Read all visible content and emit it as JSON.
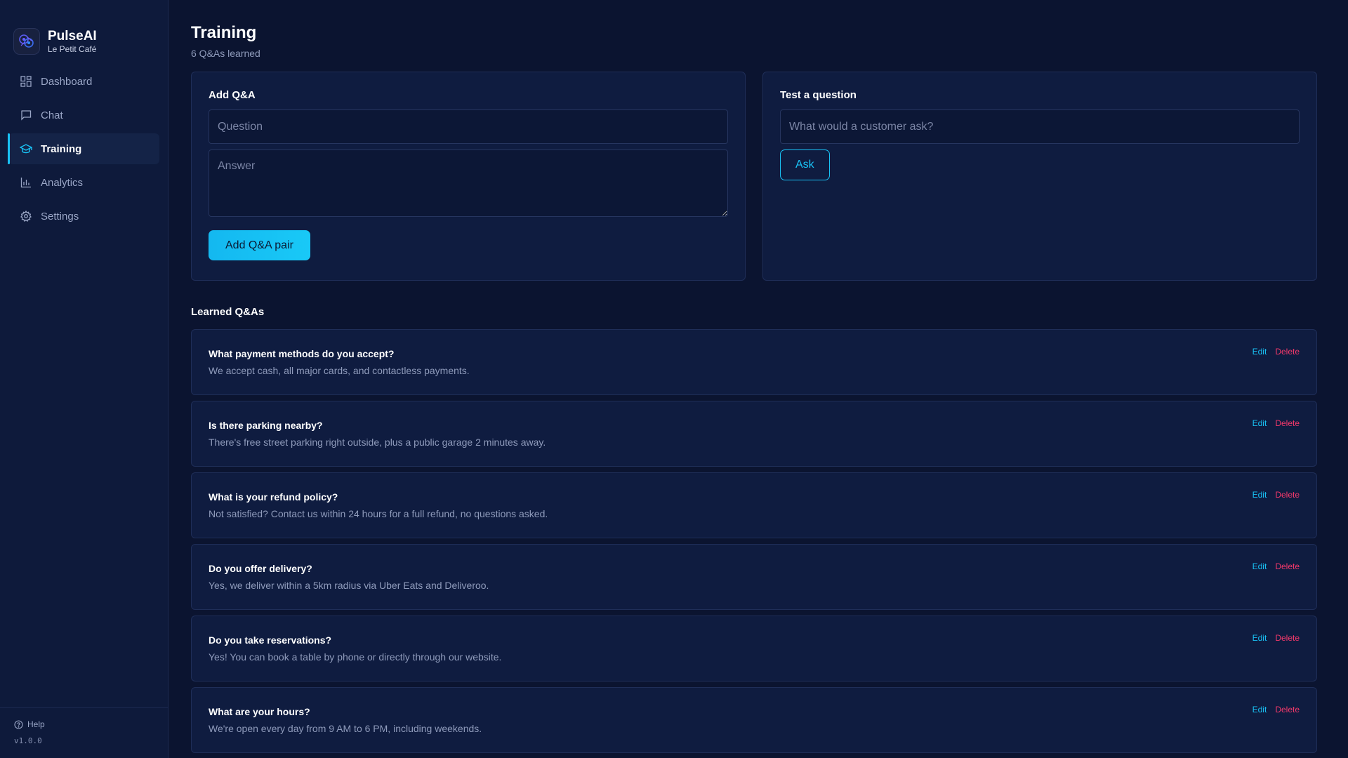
{
  "brand": {
    "name": "PulseAI",
    "subtitle": "Le Petit Café"
  },
  "sidebar": {
    "items": [
      {
        "label": "Dashboard",
        "icon": "grid-icon"
      },
      {
        "label": "Chat",
        "icon": "chat-icon"
      },
      {
        "label": "Training",
        "icon": "graduation-cap-icon",
        "active": true
      },
      {
        "label": "Analytics",
        "icon": "bar-chart-icon"
      },
      {
        "label": "Settings",
        "icon": "gear-icon"
      }
    ],
    "help_label": "Help",
    "version": "v1.0.0"
  },
  "header": {
    "title": "Training",
    "subtitle": "6 Q&As learned"
  },
  "add_qa": {
    "title": "Add Q&A",
    "question_placeholder": "Question",
    "answer_placeholder": "Answer",
    "submit_label": "Add Q&A pair"
  },
  "test": {
    "title": "Test a question",
    "placeholder": "What would a customer ask?",
    "ask_label": "Ask"
  },
  "learned": {
    "title": "Learned Q&As",
    "edit_label": "Edit",
    "delete_label": "Delete",
    "items": [
      {
        "question": "What payment methods do you accept?",
        "answer": "We accept cash, all major cards, and contactless payments."
      },
      {
        "question": "Is there parking nearby?",
        "answer": "There's free street parking right outside, plus a public garage 2 minutes away."
      },
      {
        "question": "What is your refund policy?",
        "answer": "Not satisfied? Contact us within 24 hours for a full refund, no questions asked."
      },
      {
        "question": "Do you offer delivery?",
        "answer": "Yes, we deliver within a 5km radius via Uber Eats and Deliveroo."
      },
      {
        "question": "Do you take reservations?",
        "answer": "Yes! You can book a table by phone or directly through our website."
      },
      {
        "question": "What are your hours?",
        "answer": "We're open every day from 9 AM to 6 PM, including weekends."
      }
    ]
  },
  "colors": {
    "accent": "#19c2f5",
    "danger": "#f5396b",
    "background": "#0b1430",
    "card": "#0f1c40"
  }
}
